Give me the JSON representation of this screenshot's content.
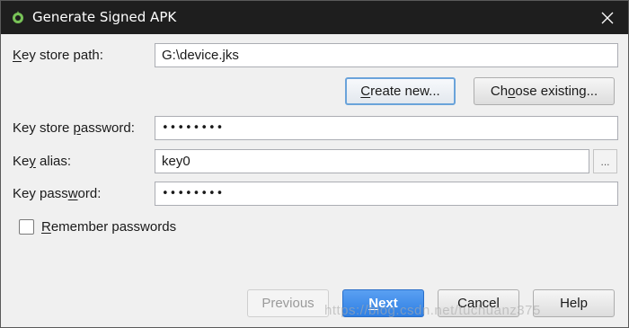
{
  "window": {
    "title": "Generate Signed APK",
    "icon": "android-studio-icon",
    "close_icon": "close-icon"
  },
  "form": {
    "key_store_path": {
      "label_pre": "",
      "label_mnemonic": "K",
      "label_post": "ey store path:",
      "value": "G:\\device.jks"
    },
    "create_new": {
      "label_pre": "",
      "label_mnemonic": "C",
      "label_post": "reate new..."
    },
    "choose_existing": {
      "label_pre": "Ch",
      "label_mnemonic": "o",
      "label_post": "ose existing..."
    },
    "key_store_password": {
      "label_pre": "Key store ",
      "label_mnemonic": "p",
      "label_post": "assword:",
      "value": "••••••••"
    },
    "key_alias": {
      "label_pre": "Ke",
      "label_mnemonic": "y",
      "label_post": " alias:",
      "value": "key0",
      "browse_label": "..."
    },
    "key_password": {
      "label_pre": "Key pass",
      "label_mnemonic": "w",
      "label_post": "ord:",
      "value": "••••••••"
    },
    "remember": {
      "label_pre": "",
      "label_mnemonic": "R",
      "label_post": "emember passwords",
      "checked": false
    }
  },
  "footer": {
    "previous": "Previous",
    "next_pre": "",
    "next_mnemonic": "N",
    "next_post": "ext",
    "cancel": "Cancel",
    "help": "Help"
  },
  "watermark": "https://blog.csdn.net/tuchuanz375",
  "colors": {
    "titlebar": "#1e1e1e",
    "primary": "#3d8ee8",
    "focus_border": "#6aa3da"
  }
}
